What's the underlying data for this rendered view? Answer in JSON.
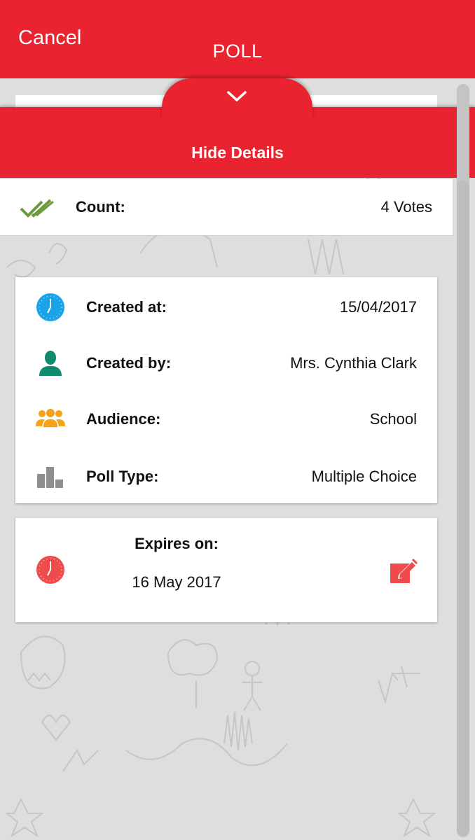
{
  "header": {
    "cancel_label": "Cancel",
    "title": "POLL"
  },
  "details": {
    "toggle_label": "Hide Details",
    "toggle_icon": "chevron-down-icon",
    "count": {
      "icon": "double-check-icon",
      "label": "Count:",
      "value": "4 Votes"
    },
    "info_rows": [
      {
        "icon": "clock-icon",
        "label": "Created at:",
        "value": "15/04/2017"
      },
      {
        "icon": "person-icon",
        "label": "Created by:",
        "value": "Mrs. Cynthia Clark"
      },
      {
        "icon": "group-icon",
        "label": "Audience:",
        "value": "School"
      },
      {
        "icon": "bar-chart-icon",
        "label": "Poll Type:",
        "value": "Multiple Choice"
      }
    ],
    "expiry": {
      "icon": "clock-icon",
      "label": "Expires on:",
      "value": "16 May 2017",
      "edit_icon": "edit-icon"
    }
  },
  "colors": {
    "brand_red": "#ea2330",
    "check_green": "#6a9a3a",
    "clock_blue": "#1aa3e8",
    "person_teal": "#0e8a6e",
    "group_orange": "#f5a21b",
    "chart_gray": "#8e8e8e",
    "expiry_red": "#f04b4b"
  }
}
